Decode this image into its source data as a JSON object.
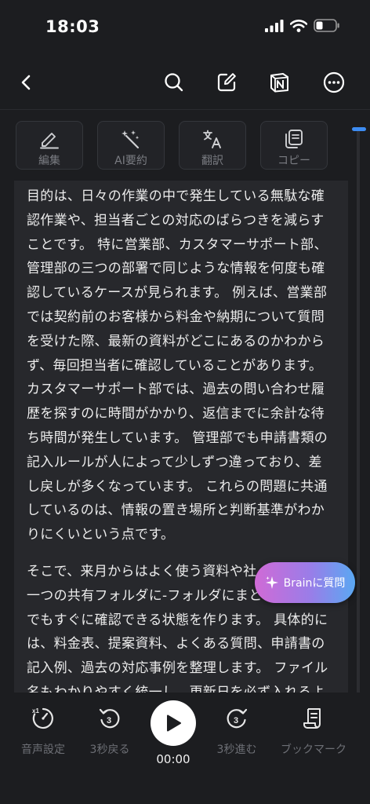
{
  "status": {
    "time": "18:03"
  },
  "toolbar": {
    "items": [
      {
        "label": "編集",
        "icon": "pencil-icon"
      },
      {
        "label": "AI要約",
        "icon": "magic-wand-icon"
      },
      {
        "label": "翻訳",
        "icon": "translate-icon"
      },
      {
        "label": "コピー",
        "icon": "copy-icon"
      }
    ]
  },
  "content": {
    "paragraph1_lines": [
      "目的は、日々の作業の中で発生している無駄な確",
      "認作業や、担当者ごとの対応のばらつきを減らす",
      "ことです。 特に営業部、カスタマーサポート部、",
      "管理部の三つの部署で同じような情報を何度も確",
      "認しているケースが見られます。 例えば、営業部",
      "では契約前のお客様から料金や納期について質問",
      "を受けた際、最新の資料がどこにあるのかわから",
      "ず、毎回担当者に確認していることがあります。",
      "カスタマーサポート部では、過去の問い合わせ履",
      "歴を探すのに時間がかかり、返信までに余計な待",
      "ち時間が発生しています。 管理部でも申請書類の",
      "記入ルールが人によって少しずつ違っており、差",
      "し戻しが多くなっています。 これらの問題に共通",
      "しているのは、情報の置き場所と判断基準がわか",
      "りにくいという点です。"
    ],
    "paragraph2_lines": [
      "そこで、来月からはよく使う資料や社",
      "一つの共有フォルダに-フォルダにまと",
      "でもすぐに確認できる状態を作ります。 具体的に",
      "は、料金表、提案資料、よくある質問、申請書の",
      "記入例、過去の対応事例を整理します。 ファイル",
      "名もわかりやすく統一し、更新日を必ず入れるよ"
    ]
  },
  "brain_button": {
    "label": "Brainに質問"
  },
  "player": {
    "controls": [
      {
        "label": "音声設定",
        "icon": "playback-speed-icon"
      },
      {
        "label": "3秒戻る",
        "icon": "rewind-3-icon"
      },
      {
        "label": "3秒進む",
        "icon": "forward-3-icon"
      },
      {
        "label": "ブックマーク",
        "icon": "bookmark-icon"
      }
    ],
    "time": "00:00",
    "speed_badge": "x1",
    "skip_seconds": "3"
  },
  "colors": {
    "background": "#1c1d20",
    "panel": "#27282c",
    "accent": "#3d8cf2",
    "brain_gradient_start": "#d06ad6",
    "brain_gradient_end": "#5aa8f2"
  }
}
